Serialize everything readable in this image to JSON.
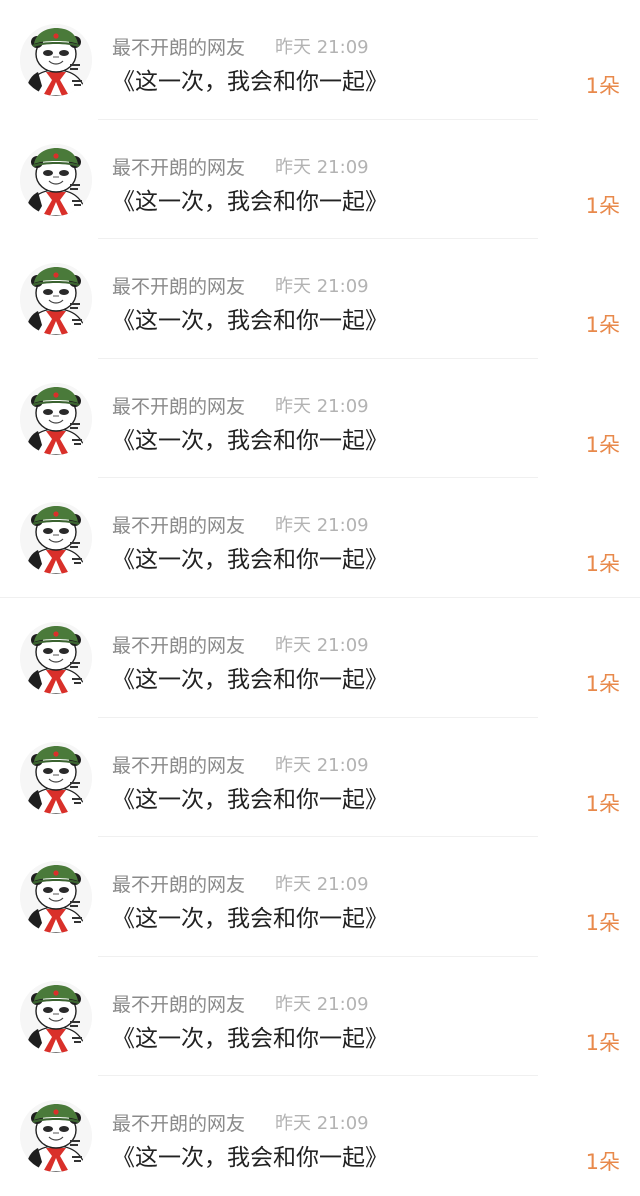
{
  "comments": [
    {
      "username": "最不开朗的网友",
      "time": "昨天 21:09",
      "message": "《这一次，我会和你一起》",
      "gift": "1朵",
      "avatar_icon": "panda-meme-avatar-icon"
    },
    {
      "username": "最不开朗的网友",
      "time": "昨天 21:09",
      "message": "《这一次，我会和你一起》",
      "gift": "1朵",
      "avatar_icon": "panda-meme-avatar-icon"
    },
    {
      "username": "最不开朗的网友",
      "time": "昨天 21:09",
      "message": "《这一次，我会和你一起》",
      "gift": "1朵",
      "avatar_icon": "panda-meme-avatar-icon"
    },
    {
      "username": "最不开朗的网友",
      "time": "昨天 21:09",
      "message": "《这一次，我会和你一起》",
      "gift": "1朵",
      "avatar_icon": "panda-meme-avatar-icon"
    },
    {
      "username": "最不开朗的网友",
      "time": "昨天 21:09",
      "message": "《这一次，我会和你一起》",
      "gift": "1朵",
      "avatar_icon": "panda-meme-avatar-icon"
    },
    {
      "username": "最不开朗的网友",
      "time": "昨天 21:09",
      "message": "《这一次，我会和你一起》",
      "gift": "1朵",
      "avatar_icon": "panda-meme-avatar-icon"
    },
    {
      "username": "最不开朗的网友",
      "time": "昨天 21:09",
      "message": "《这一次，我会和你一起》",
      "gift": "1朵",
      "avatar_icon": "panda-meme-avatar-icon"
    },
    {
      "username": "最不开朗的网友",
      "time": "昨天 21:09",
      "message": "《这一次，我会和你一起》",
      "gift": "1朵",
      "avatar_icon": "panda-meme-avatar-icon"
    },
    {
      "username": "最不开朗的网友",
      "time": "昨天 21:09",
      "message": "《这一次，我会和你一起》",
      "gift": "1朵",
      "avatar_icon": "panda-meme-avatar-icon"
    },
    {
      "username": "最不开朗的网友",
      "time": "昨天 21:09",
      "message": "《这一次，我会和你一起》",
      "gift": "1朵",
      "avatar_icon": "panda-meme-avatar-icon"
    }
  ],
  "colors": {
    "username": "#8a8a8a",
    "time": "#b3b3b3",
    "message": "#222222",
    "gift": "#e8894b",
    "divider": "#f0f0f0",
    "hat": "#4a7a3a",
    "scarf": "#d9302a"
  }
}
